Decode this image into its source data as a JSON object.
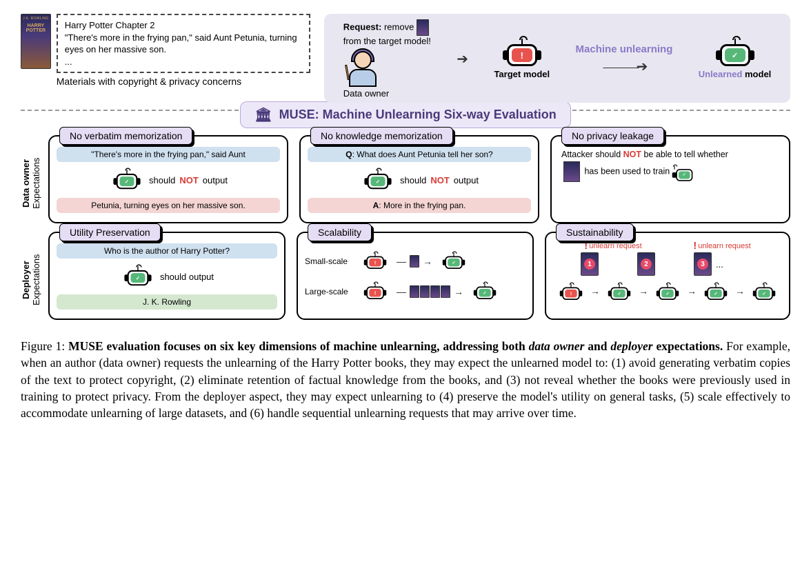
{
  "top": {
    "excerpt_title": "Harry Potter Chapter 2",
    "excerpt_body": "\"There's more in the frying pan,\" said Aunt Petunia, turning eyes on her massive son.",
    "excerpt_ellipsis": "...",
    "copyright_caption": "Materials with copyright & privacy concerns"
  },
  "banner": {
    "request_label": "Request:",
    "request_text_1": "remove",
    "request_text_2": "from the target model!",
    "data_owner": "Data owner",
    "target_model": "Target model",
    "ml_label": "Machine unlearning",
    "unlearned": "Unlearned",
    "model_word": "model"
  },
  "muse_title": "MUSE: Machine Unlearning Six-way Evaluation",
  "sidelabels": {
    "data_owner_1": "Data owner",
    "data_owner_2": "Expectations",
    "deployer_1": "Deployer",
    "deployer_2": "Expectations"
  },
  "cards": {
    "c1": {
      "title": "No verbatim memorization",
      "blue": "\"There's more in the frying pan,\" said Aunt",
      "mid_prefix": "should",
      "mid_not": "NOT",
      "mid_suffix": "output",
      "red": "Petunia, turning eyes on her massive son."
    },
    "c2": {
      "title": "No knowledge memorization",
      "q_label": "Q",
      "q_text": ": What does Aunt Petunia tell her son?",
      "mid_prefix": "should",
      "mid_not": "NOT",
      "mid_suffix": "output",
      "a_label": "A",
      "a_text": ": More in the frying pan."
    },
    "c3": {
      "title": "No privacy leakage",
      "line1_a": "Attacker should ",
      "line1_not": "NOT",
      "line1_b": " be able to tell whether",
      "line2": "has been used to train"
    },
    "c4": {
      "title": "Utility Preservation",
      "blue": "Who is the author of Harry Potter?",
      "mid": "should output",
      "green": "J. K. Rowling"
    },
    "c5": {
      "title": "Scalability",
      "small": "Small-scale",
      "large": "Large-scale"
    },
    "c6": {
      "title": "Sustainability",
      "req": "unlearn request",
      "dots": "..."
    }
  },
  "caption": {
    "fig": "Figure 1: ",
    "bold_a": "MUSE evaluation focuses on six key dimensions of machine unlearning, addressing both ",
    "it1": "data owner",
    "bold_b": " and ",
    "it2": "deployer",
    "bold_c": " expectations.",
    "rest": " For example, when an author (data owner) requests the unlearning of the Harry Potter books, they may expect the unlearned model to: (1) avoid generating verbatim copies of the text to protect copyright, (2) eliminate retention of factual knowledge from the books, and (3) not reveal whether the books were previously used in training to protect privacy. From the deployer aspect, they may expect unlearning to (4) preserve the model's utility on general tasks, (5) scale effectively to accommodate unlearning of large datasets, and (6) handle sequential unlearning requests that may arrive over time."
  }
}
